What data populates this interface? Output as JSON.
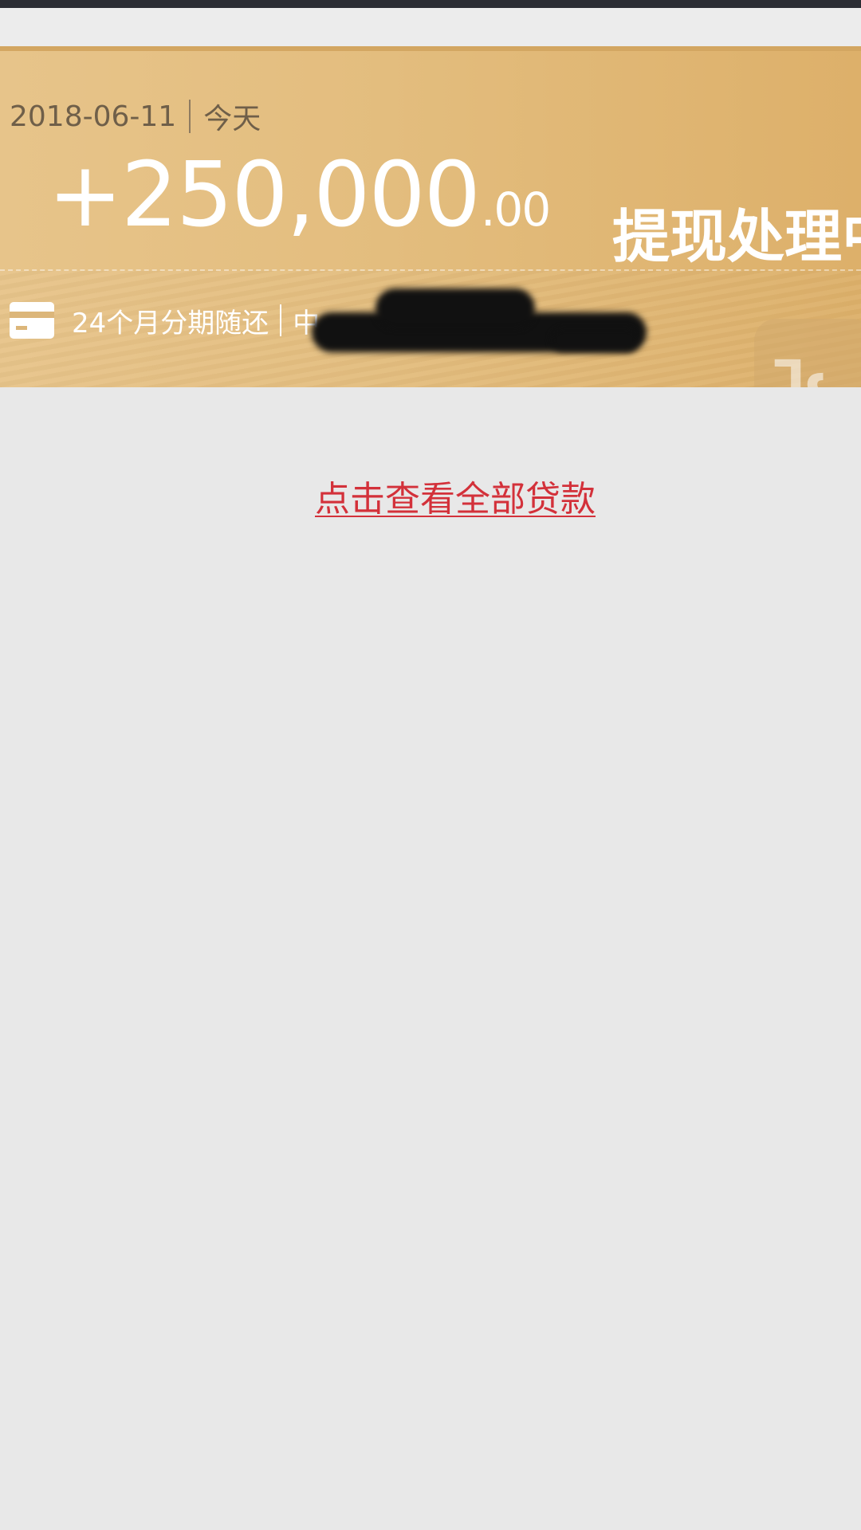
{
  "loan_record": {
    "date": "2018-06-11",
    "day_label": "今天",
    "amount_main": "+250,000",
    "amount_decimal": ".00",
    "status": "提现处理中",
    "plan": "24个月分期随还",
    "plan_extra_visible": "中"
  },
  "actions": {
    "view_all_label": "点击查看全部贷款"
  },
  "colors": {
    "card_gold": "#e3bd7e",
    "link_red": "#d3313a",
    "background": "#e8e8e8"
  }
}
